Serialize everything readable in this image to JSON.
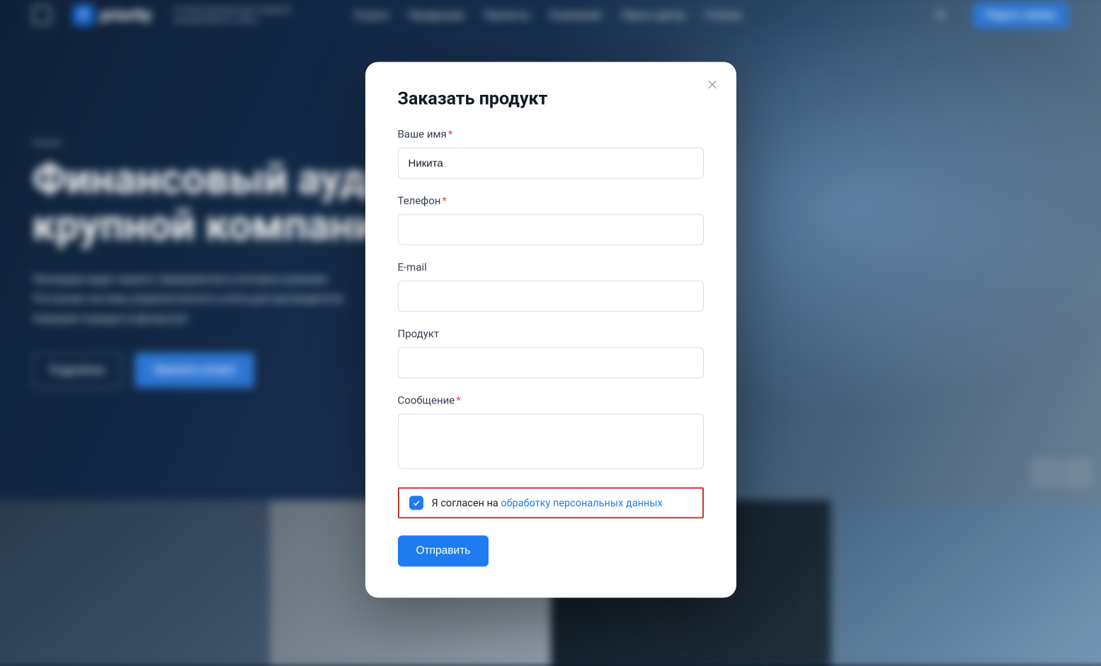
{
  "header": {
    "logo_text": "priority",
    "logo_badge": "P",
    "tagline": "Готовое решение для создания корпоративного сайта",
    "nav": [
      "Услуги",
      "Продукция",
      "Проекты",
      "Компания",
      "Пресс-центр",
      "Статьи"
    ],
    "cta": "Подать заявку"
  },
  "hero": {
    "chip": "Услуга",
    "title_line1": "Финансовый аудит",
    "title_line2": "крупной компании",
    "sub1": "Проведем аудит вашего предприятия в экспресс-режиме.",
    "sub2": "Построим систему управленческого учета для руководителя.",
    "sub3": "Наведем порядок в финансах!",
    "btn_more": "Подробнее",
    "btn_order": "Заказать услугу"
  },
  "modal": {
    "title": "Заказать продукт",
    "fields": {
      "name": {
        "label": "Ваше имя",
        "required": true,
        "value": "Никита"
      },
      "phone": {
        "label": "Телефон",
        "required": true,
        "value": ""
      },
      "email": {
        "label": "E-mail",
        "required": false,
        "value": ""
      },
      "product": {
        "label": "Продукт",
        "required": false,
        "value": ""
      },
      "message": {
        "label": "Сообщение",
        "required": true,
        "value": ""
      }
    },
    "consent": {
      "checked": true,
      "text_prefix": "Я согласен на ",
      "link_text": "обработку персональных данных"
    },
    "submit": "Отправить"
  }
}
